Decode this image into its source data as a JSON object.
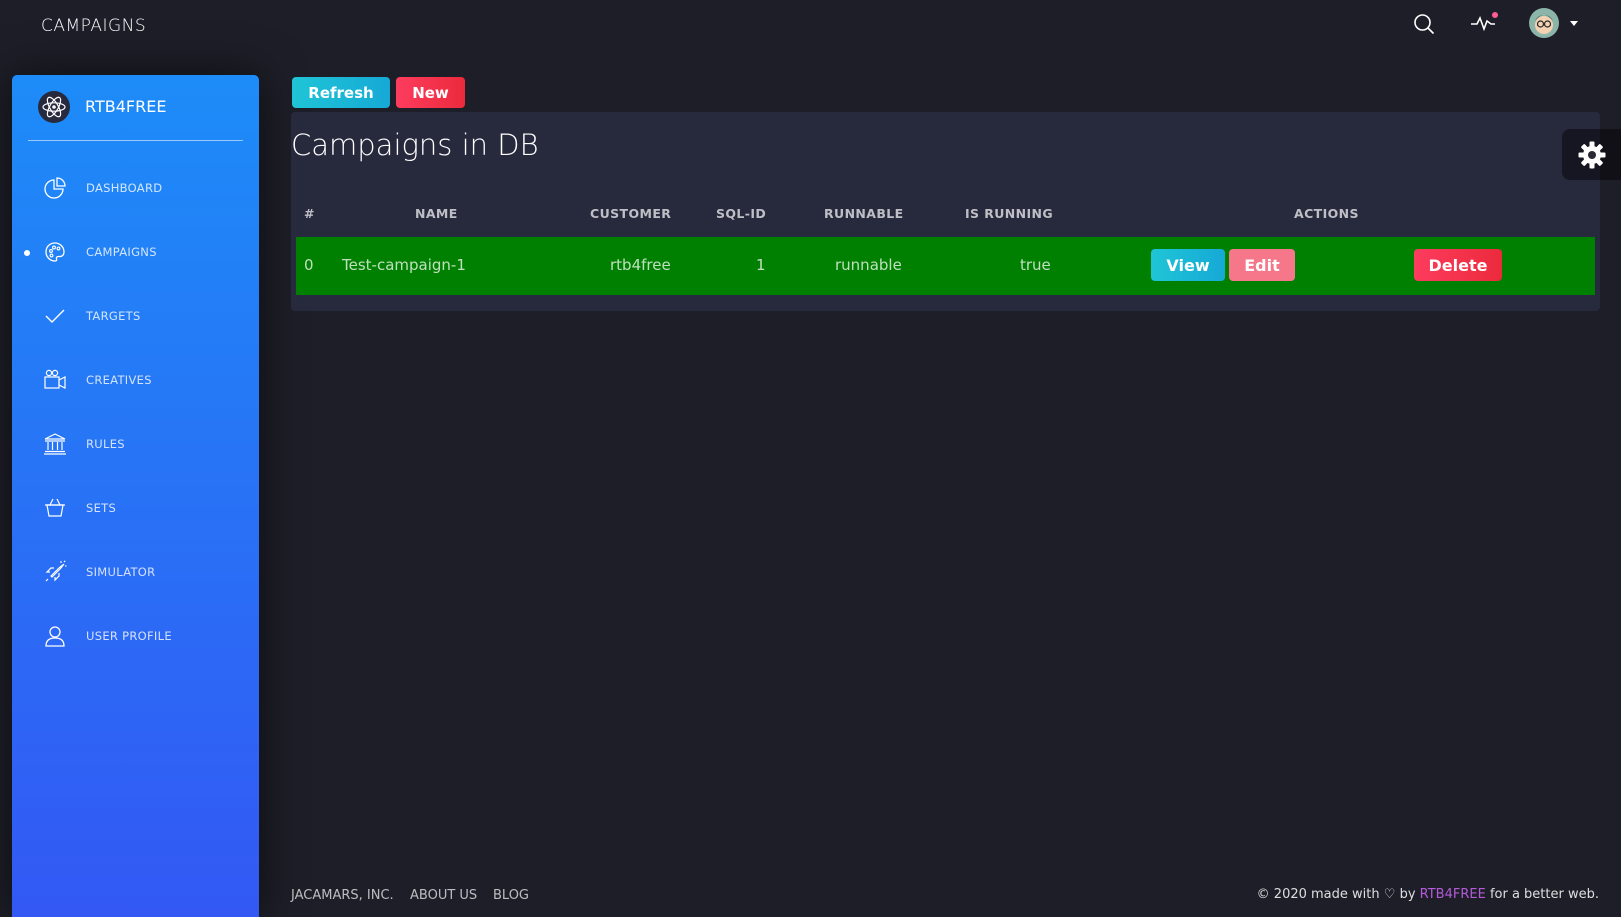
{
  "header": {
    "title": "CAMPAIGNS",
    "icons": [
      "search-icon",
      "pulse-icon",
      "avatar"
    ]
  },
  "sidebar": {
    "logo_text": "RTB4FREE",
    "items": [
      {
        "label": "DASHBOARD",
        "icon": "pie-chart-icon",
        "active": false
      },
      {
        "label": "CAMPAIGNS",
        "icon": "palette-icon",
        "active": true
      },
      {
        "label": "TARGETS",
        "icon": "check-icon",
        "active": false
      },
      {
        "label": "CREATIVES",
        "icon": "video-camera-icon",
        "active": false
      },
      {
        "label": "RULES",
        "icon": "bank-icon",
        "active": false
      },
      {
        "label": "SETS",
        "icon": "basket-icon",
        "active": false
      },
      {
        "label": "SIMULATOR",
        "icon": "spaceship-icon",
        "active": false
      },
      {
        "label": "USER PROFILE",
        "icon": "user-icon",
        "active": false
      }
    ]
  },
  "toolbar": {
    "refresh_label": "Refresh",
    "new_label": "New"
  },
  "card": {
    "title": "Campaigns in DB",
    "columns": [
      "#",
      "NAME",
      "CUSTOMER",
      "SQL-ID",
      "RUNNABLE",
      "IS RUNNING",
      "ACTIONS"
    ],
    "rows": [
      {
        "index": "0",
        "name": "Test-campaign-1",
        "customer": "rtb4free",
        "sql_id": "1",
        "runnable": "runnable",
        "is_running": "true",
        "actions": {
          "view": "View",
          "edit": "Edit",
          "delete": "Delete"
        },
        "row_color": "#008000"
      }
    ]
  },
  "footer": {
    "links": [
      "JACAMARS, INC.",
      "ABOUT US",
      "BLOG"
    ],
    "copyright_prefix": "© 2020 made with",
    "copyright_by": "by",
    "brand": "RTB4FREE",
    "copyright_suffix": "for a better web."
  },
  "colors": {
    "background": "#1e1e28",
    "card": "#27293d",
    "sidebar_start": "#1d8cf8",
    "sidebar_end": "#3358f4",
    "info": "#1fc5d6",
    "danger": "#fd3c5e",
    "edit": "#f6768a",
    "row_success": "#008000",
    "brand_link": "#b35ad8"
  }
}
